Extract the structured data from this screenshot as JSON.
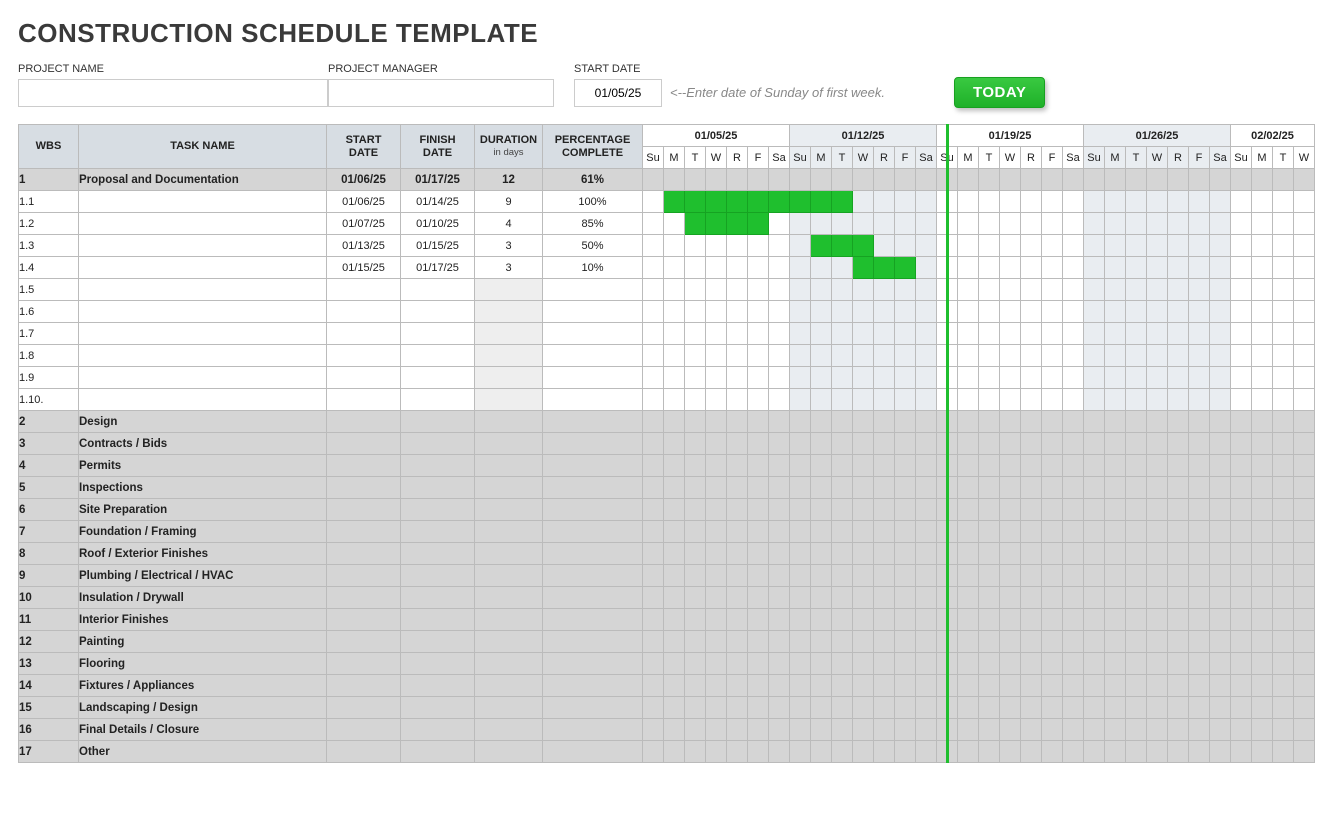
{
  "title": "CONSTRUCTION SCHEDULE TEMPLATE",
  "meta": {
    "projectNameLabel": "PROJECT NAME",
    "projectManagerLabel": "PROJECT MANAGER",
    "startDateLabel": "START DATE",
    "projectName": "",
    "projectManager": "",
    "startDate": "01/05/25",
    "hint": "<--Enter date of Sunday of first week.",
    "todayLabel": "TODAY"
  },
  "columns": {
    "wbs": "WBS",
    "task": "TASK NAME",
    "start": "START DATE",
    "finish": "FINISH DATE",
    "duration": "DURATION",
    "durationSub": "in days",
    "percent": "PERCENTAGE COMPLETE"
  },
  "weeks": [
    {
      "label": "01/05/25",
      "days": [
        "Su",
        "M",
        "T",
        "W",
        "R",
        "F",
        "Sa"
      ],
      "shade": false
    },
    {
      "label": "01/12/25",
      "days": [
        "Su",
        "M",
        "T",
        "W",
        "R",
        "F",
        "Sa"
      ],
      "shade": true
    },
    {
      "label": "01/19/25",
      "days": [
        "Su",
        "M",
        "T",
        "W",
        "R",
        "F",
        "Sa"
      ],
      "shade": false
    },
    {
      "label": "01/26/25",
      "days": [
        "Su",
        "M",
        "T",
        "W",
        "R",
        "F",
        "Sa"
      ],
      "shade": true
    },
    {
      "label": "02/02/25",
      "days": [
        "Su",
        "M",
        "T",
        "W"
      ],
      "shade": false
    }
  ],
  "rows": [
    {
      "type": "section",
      "wbs": "1",
      "task": "Proposal and Documentation",
      "start": "01/06/25",
      "finish": "01/17/25",
      "dur": "12",
      "pct": "61%",
      "bars": []
    },
    {
      "type": "task",
      "wbs": "1.1",
      "task": "",
      "start": "01/06/25",
      "finish": "01/14/25",
      "dur": "9",
      "pct": "100%",
      "bars": [
        1,
        2,
        3,
        4,
        5,
        6,
        7,
        8,
        9
      ]
    },
    {
      "type": "task",
      "wbs": "1.2",
      "task": "",
      "start": "01/07/25",
      "finish": "01/10/25",
      "dur": "4",
      "pct": "85%",
      "bars": [
        2,
        3,
        4,
        5
      ]
    },
    {
      "type": "task",
      "wbs": "1.3",
      "task": "",
      "start": "01/13/25",
      "finish": "01/15/25",
      "dur": "3",
      "pct": "50%",
      "bars": [
        8,
        9,
        10
      ]
    },
    {
      "type": "task",
      "wbs": "1.4",
      "task": "",
      "start": "01/15/25",
      "finish": "01/17/25",
      "dur": "3",
      "pct": "10%",
      "bars": [
        10,
        11,
        12
      ]
    },
    {
      "type": "blank",
      "wbs": "1.5",
      "task": "",
      "start": "",
      "finish": "",
      "dur": "",
      "pct": "",
      "bars": []
    },
    {
      "type": "blank",
      "wbs": "1.6",
      "task": "",
      "start": "",
      "finish": "",
      "dur": "",
      "pct": "",
      "bars": []
    },
    {
      "type": "blank",
      "wbs": "1.7",
      "task": "",
      "start": "",
      "finish": "",
      "dur": "",
      "pct": "",
      "bars": []
    },
    {
      "type": "blank",
      "wbs": "1.8",
      "task": "",
      "start": "",
      "finish": "",
      "dur": "",
      "pct": "",
      "bars": []
    },
    {
      "type": "blank",
      "wbs": "1.9",
      "task": "",
      "start": "",
      "finish": "",
      "dur": "",
      "pct": "",
      "bars": []
    },
    {
      "type": "blank",
      "wbs": "1.10.",
      "task": "",
      "start": "",
      "finish": "",
      "dur": "",
      "pct": "",
      "bars": []
    },
    {
      "type": "section",
      "wbs": "2",
      "task": "Design",
      "start": "",
      "finish": "",
      "dur": "",
      "pct": "",
      "bars": []
    },
    {
      "type": "section",
      "wbs": "3",
      "task": "Contracts / Bids",
      "start": "",
      "finish": "",
      "dur": "",
      "pct": "",
      "bars": []
    },
    {
      "type": "section",
      "wbs": "4",
      "task": "Permits",
      "start": "",
      "finish": "",
      "dur": "",
      "pct": "",
      "bars": []
    },
    {
      "type": "section",
      "wbs": "5",
      "task": "Inspections",
      "start": "",
      "finish": "",
      "dur": "",
      "pct": "",
      "bars": []
    },
    {
      "type": "section",
      "wbs": "6",
      "task": "Site Preparation",
      "start": "",
      "finish": "",
      "dur": "",
      "pct": "",
      "bars": []
    },
    {
      "type": "section",
      "wbs": "7",
      "task": "Foundation / Framing",
      "start": "",
      "finish": "",
      "dur": "",
      "pct": "",
      "bars": []
    },
    {
      "type": "section",
      "wbs": "8",
      "task": "Roof / Exterior Finishes",
      "start": "",
      "finish": "",
      "dur": "",
      "pct": "",
      "bars": []
    },
    {
      "type": "section",
      "wbs": "9",
      "task": "Plumbing / Electrical / HVAC",
      "start": "",
      "finish": "",
      "dur": "",
      "pct": "",
      "bars": []
    },
    {
      "type": "section",
      "wbs": "10",
      "task": "Insulation / Drywall",
      "start": "",
      "finish": "",
      "dur": "",
      "pct": "",
      "bars": []
    },
    {
      "type": "section",
      "wbs": "11",
      "task": "Interior Finishes",
      "start": "",
      "finish": "",
      "dur": "",
      "pct": "",
      "bars": []
    },
    {
      "type": "section",
      "wbs": "12",
      "task": "Painting",
      "start": "",
      "finish": "",
      "dur": "",
      "pct": "",
      "bars": []
    },
    {
      "type": "section",
      "wbs": "13",
      "task": "Flooring",
      "start": "",
      "finish": "",
      "dur": "",
      "pct": "",
      "bars": []
    },
    {
      "type": "section",
      "wbs": "14",
      "task": "Fixtures / Appliances",
      "start": "",
      "finish": "",
      "dur": "",
      "pct": "",
      "bars": []
    },
    {
      "type": "section",
      "wbs": "15",
      "task": "Landscaping / Design",
      "start": "",
      "finish": "",
      "dur": "",
      "pct": "",
      "bars": []
    },
    {
      "type": "section",
      "wbs": "16",
      "task": "Final Details / Closure",
      "start": "",
      "finish": "",
      "dur": "",
      "pct": "",
      "bars": []
    },
    {
      "type": "section",
      "wbs": "17",
      "task": "Other",
      "start": "",
      "finish": "",
      "dur": "",
      "pct": "",
      "bars": []
    }
  ],
  "todayColumnIndex": 14,
  "chart_data": {
    "type": "gantt",
    "timeline_start": "01/05/25",
    "day_headers": [
      "Su",
      "M",
      "T",
      "W",
      "R",
      "F",
      "Sa"
    ],
    "tasks": [
      {
        "wbs": "1",
        "name": "Proposal and Documentation",
        "start": "01/06/25",
        "finish": "01/17/25",
        "duration": 12,
        "percent_complete": 61,
        "level": 0
      },
      {
        "wbs": "1.1",
        "name": "",
        "start": "01/06/25",
        "finish": "01/14/25",
        "duration": 9,
        "percent_complete": 100,
        "level": 1
      },
      {
        "wbs": "1.2",
        "name": "",
        "start": "01/07/25",
        "finish": "01/10/25",
        "duration": 4,
        "percent_complete": 85,
        "level": 1
      },
      {
        "wbs": "1.3",
        "name": "",
        "start": "01/13/25",
        "finish": "01/15/25",
        "duration": 3,
        "percent_complete": 50,
        "level": 1
      },
      {
        "wbs": "1.4",
        "name": "",
        "start": "01/15/25",
        "finish": "01/17/25",
        "duration": 3,
        "percent_complete": 10,
        "level": 1
      },
      {
        "wbs": "2",
        "name": "Design",
        "level": 0
      },
      {
        "wbs": "3",
        "name": "Contracts / Bids",
        "level": 0
      },
      {
        "wbs": "4",
        "name": "Permits",
        "level": 0
      },
      {
        "wbs": "5",
        "name": "Inspections",
        "level": 0
      },
      {
        "wbs": "6",
        "name": "Site Preparation",
        "level": 0
      },
      {
        "wbs": "7",
        "name": "Foundation / Framing",
        "level": 0
      },
      {
        "wbs": "8",
        "name": "Roof / Exterior Finishes",
        "level": 0
      },
      {
        "wbs": "9",
        "name": "Plumbing / Electrical / HVAC",
        "level": 0
      },
      {
        "wbs": "10",
        "name": "Insulation / Drywall",
        "level": 0
      },
      {
        "wbs": "11",
        "name": "Interior Finishes",
        "level": 0
      },
      {
        "wbs": "12",
        "name": "Painting",
        "level": 0
      },
      {
        "wbs": "13",
        "name": "Flooring",
        "level": 0
      },
      {
        "wbs": "14",
        "name": "Fixtures / Appliances",
        "level": 0
      },
      {
        "wbs": "15",
        "name": "Landscaping / Design",
        "level": 0
      },
      {
        "wbs": "16",
        "name": "Final Details / Closure",
        "level": 0
      },
      {
        "wbs": "17",
        "name": "Other",
        "level": 0
      }
    ]
  }
}
